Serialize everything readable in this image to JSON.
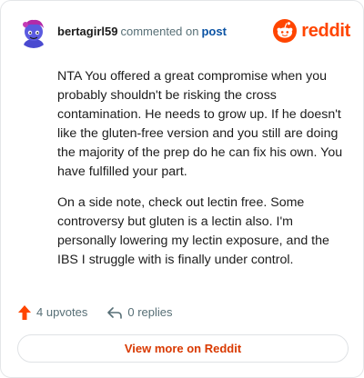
{
  "header": {
    "username": "bertagirl59",
    "action_text": "commented on",
    "post_link": "post",
    "brand": "reddit"
  },
  "comment": {
    "paragraphs": [
      "NTA You offered a great compromise when you probably shouldn't be risking the cross contamination. He needs to grow up. If he doesn't like the gluten-free version and you still are doing the majority of the prep do he can fix his own. You have fulfilled your part.",
      "On a side note, check out lectin free. Some controversy but gluten is a lectin also. I'm personally lowering my lectin exposure, and the IBS I struggle with is finally under control."
    ]
  },
  "actions": {
    "upvotes": "4 upvotes",
    "replies": "0 replies"
  },
  "footer": {
    "view_more": "View more on Reddit"
  },
  "colors": {
    "brand": "#ff4500",
    "upvote_arrow": "#ff4500",
    "link_blue": "#0b53a4",
    "view_more_text": "#d93900"
  },
  "icons": {
    "avatar": "snoo-avatar",
    "brand": "reddit-logo-icon",
    "upvote": "upvote-arrow-icon",
    "reply": "reply-arrow-icon"
  }
}
